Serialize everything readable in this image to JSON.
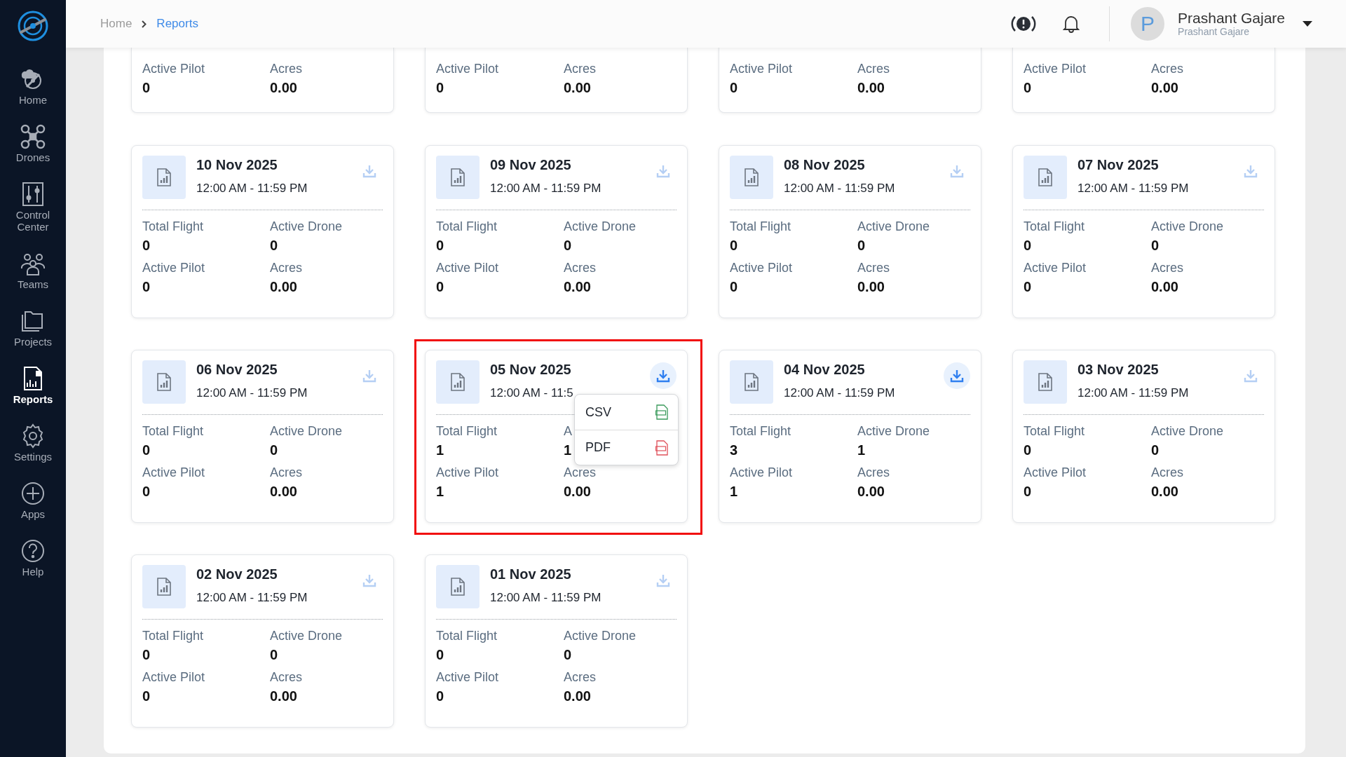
{
  "sidebar": {
    "items": [
      {
        "label": "Home",
        "kind": "home",
        "selected": false
      },
      {
        "label": "Drones",
        "kind": "drone",
        "selected": false
      },
      {
        "label": "Control Center",
        "kind": "control",
        "selected": false
      },
      {
        "label": "Teams",
        "kind": "teams",
        "selected": false
      },
      {
        "label": "Projects",
        "kind": "projects",
        "selected": false
      },
      {
        "label": "Reports",
        "kind": "reports",
        "selected": true
      },
      {
        "label": "Settings",
        "kind": "settings",
        "selected": false
      },
      {
        "label": "Apps",
        "kind": "apps",
        "selected": false
      },
      {
        "label": "Help",
        "kind": "help",
        "selected": false
      }
    ]
  },
  "header": {
    "breadcrumb": [
      {
        "label": "Home",
        "selected": false
      },
      {
        "label": "Reports",
        "selected": true
      }
    ],
    "user": {
      "initial": "P",
      "name": "Prashant Gajare",
      "subtitle": "Prashant Gajare"
    }
  },
  "partial_cards": [
    {
      "stats": [
        {
          "label": "Active Pilot",
          "value": "0"
        },
        {
          "label": "Acres",
          "value": "0.00"
        }
      ]
    },
    {
      "stats": [
        {
          "label": "Active Pilot",
          "value": "0"
        },
        {
          "label": "Acres",
          "value": "0.00"
        }
      ]
    },
    {
      "stats": [
        {
          "label": "Active Pilot",
          "value": "0"
        },
        {
          "label": "Acres",
          "value": "0.00"
        }
      ]
    },
    {
      "stats": [
        {
          "label": "Active Pilot",
          "value": "0"
        },
        {
          "label": "Acres",
          "value": "0.00"
        }
      ]
    }
  ],
  "cards": [
    {
      "date": "10 Nov 2025",
      "time": "12:00 AM - 11:59 PM",
      "download_active": false,
      "stats": [
        {
          "label": "Total Flight",
          "value": "0"
        },
        {
          "label": "Active Drone",
          "value": "0"
        },
        {
          "label": "Active Pilot",
          "value": "0"
        },
        {
          "label": "Acres",
          "value": "0.00"
        }
      ]
    },
    {
      "date": "09 Nov 2025",
      "time": "12:00 AM - 11:59 PM",
      "download_active": false,
      "stats": [
        {
          "label": "Total Flight",
          "value": "0"
        },
        {
          "label": "Active Drone",
          "value": "0"
        },
        {
          "label": "Active Pilot",
          "value": "0"
        },
        {
          "label": "Acres",
          "value": "0.00"
        }
      ]
    },
    {
      "date": "08 Nov 2025",
      "time": "12:00 AM - 11:59 PM",
      "download_active": false,
      "stats": [
        {
          "label": "Total Flight",
          "value": "0"
        },
        {
          "label": "Active Drone",
          "value": "0"
        },
        {
          "label": "Active Pilot",
          "value": "0"
        },
        {
          "label": "Acres",
          "value": "0.00"
        }
      ]
    },
    {
      "date": "07 Nov 2025",
      "time": "12:00 AM - 11:59 PM",
      "download_active": false,
      "stats": [
        {
          "label": "Total Flight",
          "value": "0"
        },
        {
          "label": "Active Drone",
          "value": "0"
        },
        {
          "label": "Active Pilot",
          "value": "0"
        },
        {
          "label": "Acres",
          "value": "0.00"
        }
      ]
    },
    {
      "date": "06 Nov 2025",
      "time": "12:00 AM - 11:59 PM",
      "download_active": false,
      "stats": [
        {
          "label": "Total Flight",
          "value": "0"
        },
        {
          "label": "Active Drone",
          "value": "0"
        },
        {
          "label": "Active Pilot",
          "value": "0"
        },
        {
          "label": "Acres",
          "value": "0.00"
        }
      ]
    },
    {
      "date": "05 Nov 2025",
      "time": "12:00 AM - 11:5",
      "download_active": true,
      "annotations": [
        {
          "kind": "frame"
        }
      ],
      "stats": [
        {
          "label": "Total Flight",
          "value": "1"
        },
        {
          "label": "A",
          "value": "1"
        },
        {
          "label": "Active Pilot",
          "value": "1"
        },
        {
          "label": "Acres",
          "value": "0.00"
        }
      ],
      "menu": [
        {
          "label": "CSV",
          "kind": "csv"
        },
        {
          "label": "PDF",
          "kind": "pdf"
        }
      ]
    },
    {
      "date": "04 Nov 2025",
      "time": "12:00 AM - 11:59 PM",
      "download_active": true,
      "stats": [
        {
          "label": "Total Flight",
          "value": "3"
        },
        {
          "label": "Active Drone",
          "value": "1"
        },
        {
          "label": "Active Pilot",
          "value": "1"
        },
        {
          "label": "Acres",
          "value": "0.00"
        }
      ]
    },
    {
      "date": "03 Nov 2025",
      "time": "12:00 AM - 11:59 PM",
      "download_active": false,
      "stats": [
        {
          "label": "Total Flight",
          "value": "0"
        },
        {
          "label": "Active Drone",
          "value": "0"
        },
        {
          "label": "Active Pilot",
          "value": "0"
        },
        {
          "label": "Acres",
          "value": "0.00"
        }
      ]
    },
    {
      "date": "02 Nov 2025",
      "time": "12:00 AM - 11:59 PM",
      "download_active": false,
      "stats": [
        {
          "label": "Total Flight",
          "value": "0"
        },
        {
          "label": "Active Drone",
          "value": "0"
        },
        {
          "label": "Active Pilot",
          "value": "0"
        },
        {
          "label": "Acres",
          "value": "0.00"
        }
      ]
    },
    {
      "date": "01 Nov 2025",
      "time": "12:00 AM - 11:59 PM",
      "download_active": false,
      "stats": [
        {
          "label": "Total Flight",
          "value": "0"
        },
        {
          "label": "Active Drone",
          "value": "0"
        },
        {
          "label": "Active Pilot",
          "value": "0"
        },
        {
          "label": "Acres",
          "value": "0.00"
        }
      ]
    }
  ]
}
